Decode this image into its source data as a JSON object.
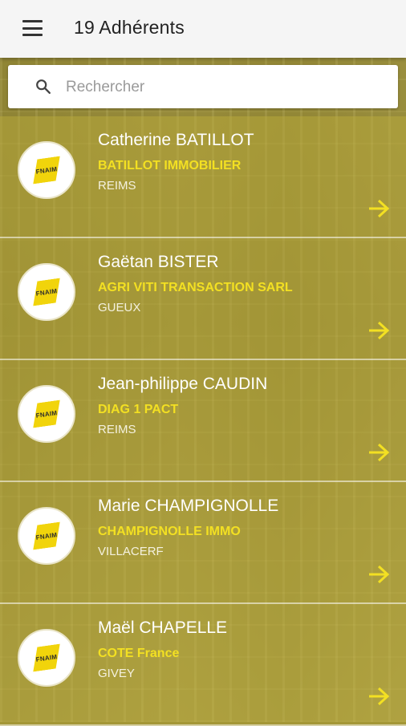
{
  "appbar": {
    "title": "19 Adhérents",
    "menu_icon": "menu-icon"
  },
  "search": {
    "placeholder": "Rechercher",
    "icon": "search-icon"
  },
  "colors": {
    "accent": "#f3e022",
    "logo_yellow": "#f1d40b"
  },
  "members": [
    {
      "name": "Catherine BATILLOT",
      "company": "BATILLOT IMMOBILIER",
      "city": "REIMS",
      "logo": "FNAIM"
    },
    {
      "name": "Gaëtan BISTER",
      "company": "AGRI VITI TRANSACTION SARL",
      "city": "GUEUX",
      "logo": "FNAIM"
    },
    {
      "name": "Jean-philippe CAUDIN",
      "company": "DIAG 1 PACT",
      "city": "REIMS",
      "logo": "FNAIM"
    },
    {
      "name": "Marie CHAMPIGNOLLE",
      "company": "CHAMPIGNOLLE IMMO",
      "city": "VILLACERF",
      "logo": "FNAIM"
    },
    {
      "name": "Maël CHAPELLE",
      "company": "COTE France",
      "city": "GIVEY",
      "logo": "FNAIM"
    }
  ]
}
